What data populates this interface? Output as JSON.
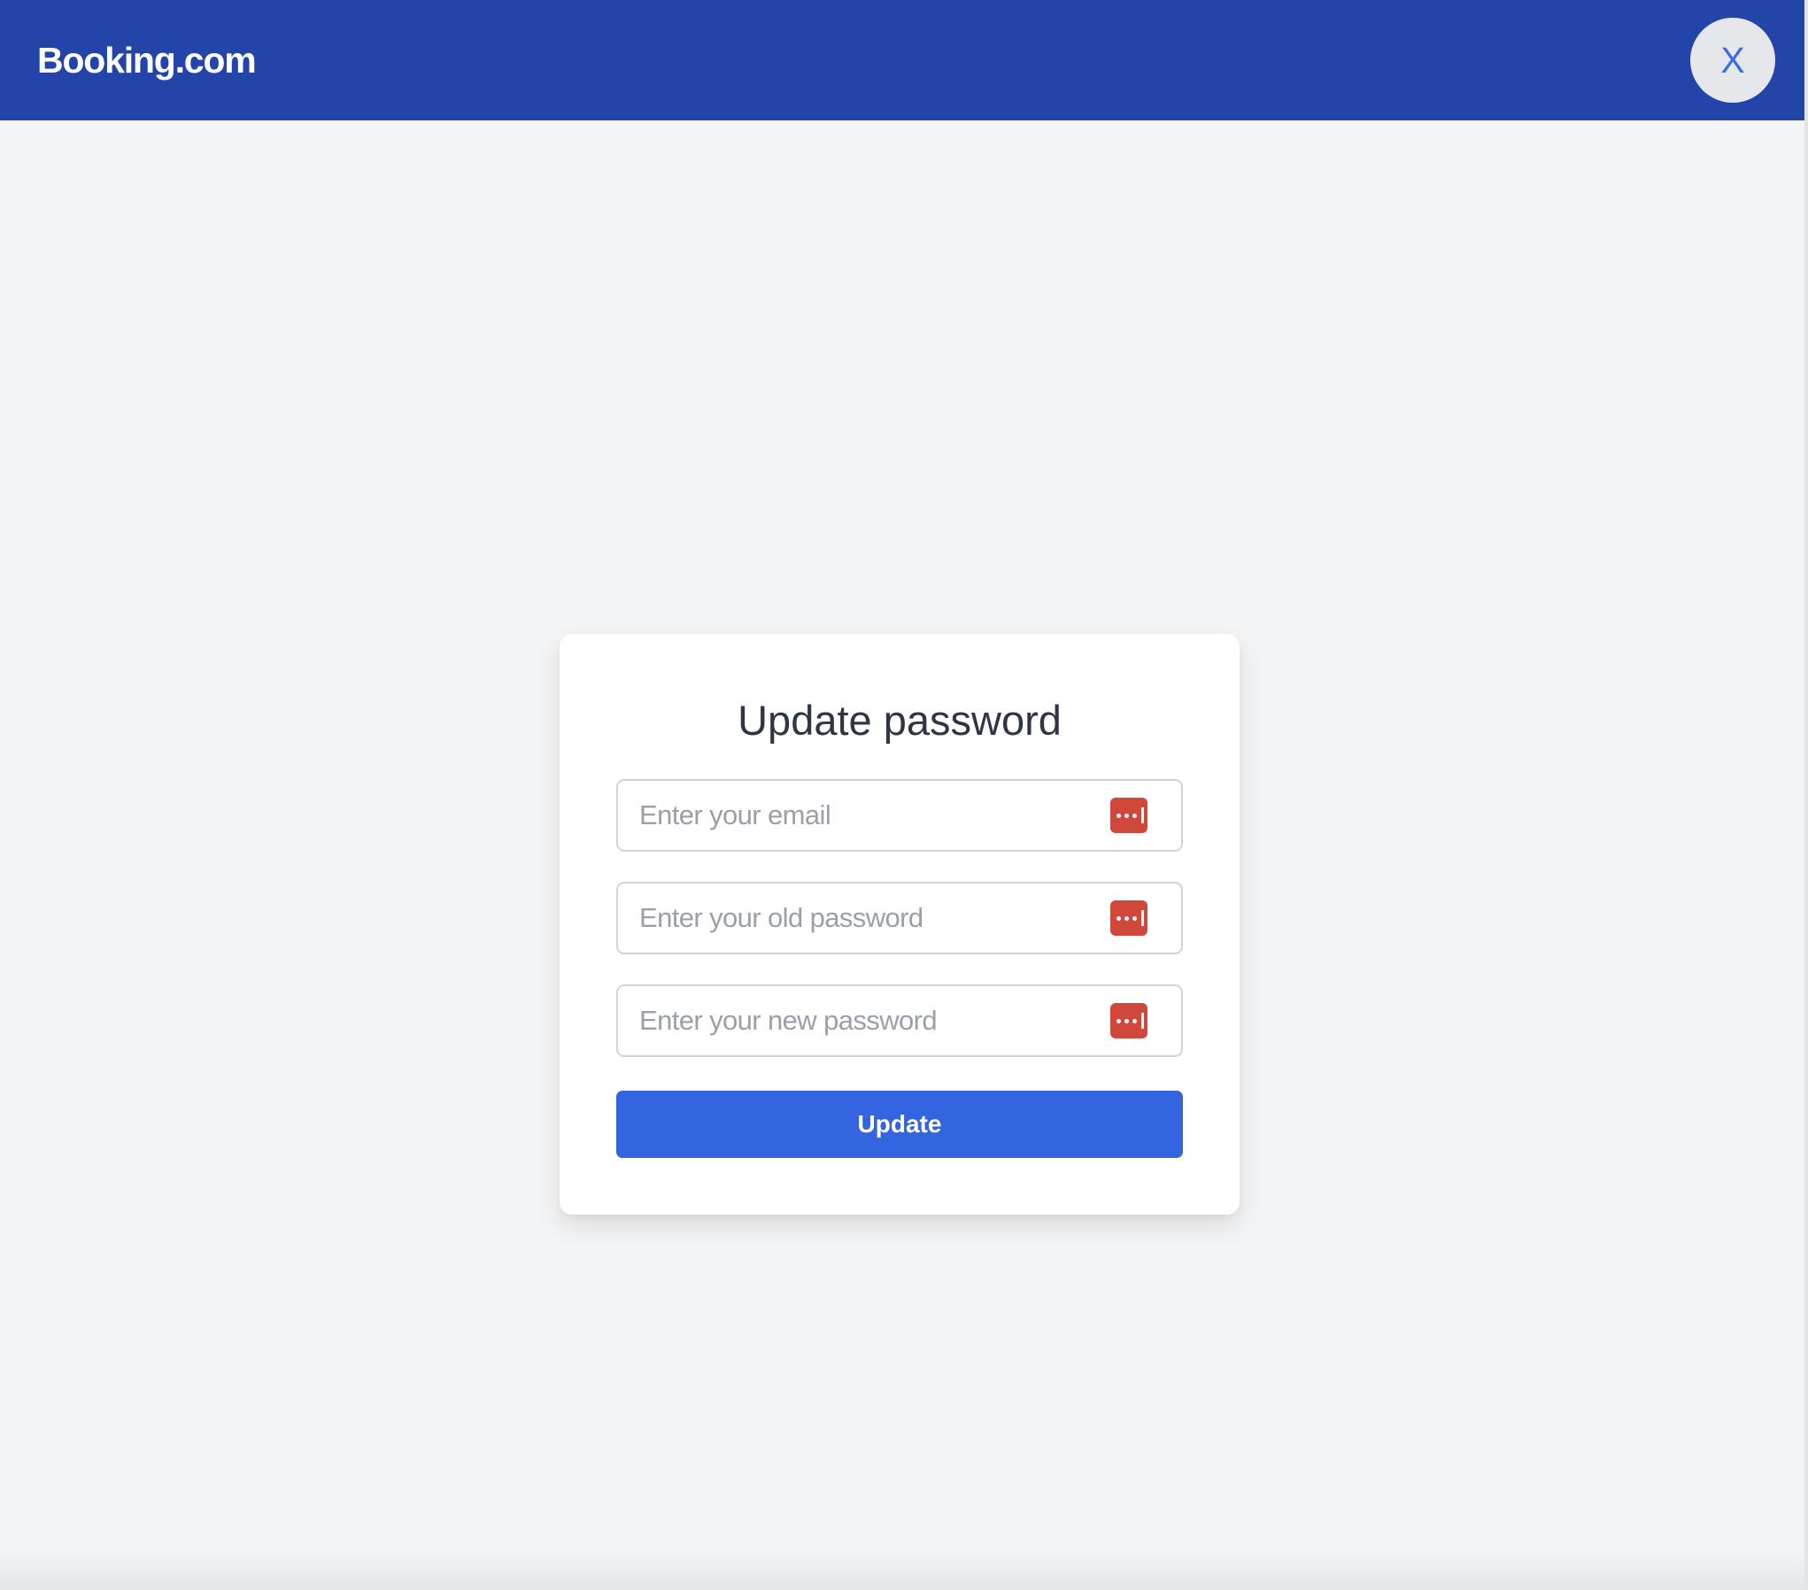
{
  "header": {
    "brand": "Booking.com",
    "close_label": "X"
  },
  "form": {
    "title": "Update password",
    "email_placeholder": "Enter your email",
    "old_password_placeholder": "Enter your old password",
    "new_password_placeholder": "Enter your new password",
    "submit_label": "Update",
    "field_icon": "password-manager-icon"
  },
  "colors": {
    "header_bg": "#2344a9",
    "page_bg": "#f3f4f6",
    "primary_button": "#3365e0",
    "close_text": "#3b6fe0",
    "password_manager_icon": "#d0473c"
  }
}
